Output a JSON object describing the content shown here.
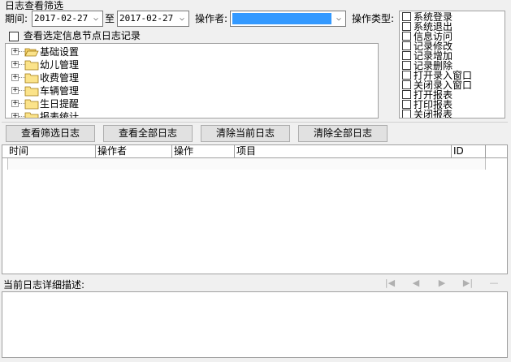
{
  "filter": {
    "group_title": "日志查看筛选",
    "period_label": "期间:",
    "date_from": "2017-02-27",
    "to_label": "至",
    "date_to": "2017-02-27",
    "operator_label": "操作者:",
    "op_type_label": "操作类型:",
    "node_log_checkbox_label": "查看选定信息节点日志记录",
    "accent_color": "#3399ff"
  },
  "tree": {
    "items": [
      {
        "label": "基础设置",
        "icon": "folder-open-icon"
      },
      {
        "label": "幼儿管理",
        "icon": "folder-icon"
      },
      {
        "label": "收费管理",
        "icon": "folder-icon"
      },
      {
        "label": "车辆管理",
        "icon": "folder-icon"
      },
      {
        "label": "生日提醒",
        "icon": "folder-icon"
      },
      {
        "label": "报表统计",
        "icon": "folder-icon"
      }
    ]
  },
  "op_types": [
    "系统登录",
    "系统退出",
    "信息访问",
    "记录修改",
    "记录增加",
    "记录删除",
    "打开录入窗口",
    "关闭录入窗口",
    "打开报表",
    "打印报表",
    "关闭报表"
  ],
  "buttons": {
    "view_filtered": "查看筛选日志",
    "view_all": "查看全部日志",
    "clear_current": "清除当前日志",
    "clear_all": "清除全部日志"
  },
  "table": {
    "columns": [
      "时间",
      "操作者",
      "操作",
      "项目",
      "ID"
    ]
  },
  "detail": {
    "label": "当前日志详细描述:"
  }
}
